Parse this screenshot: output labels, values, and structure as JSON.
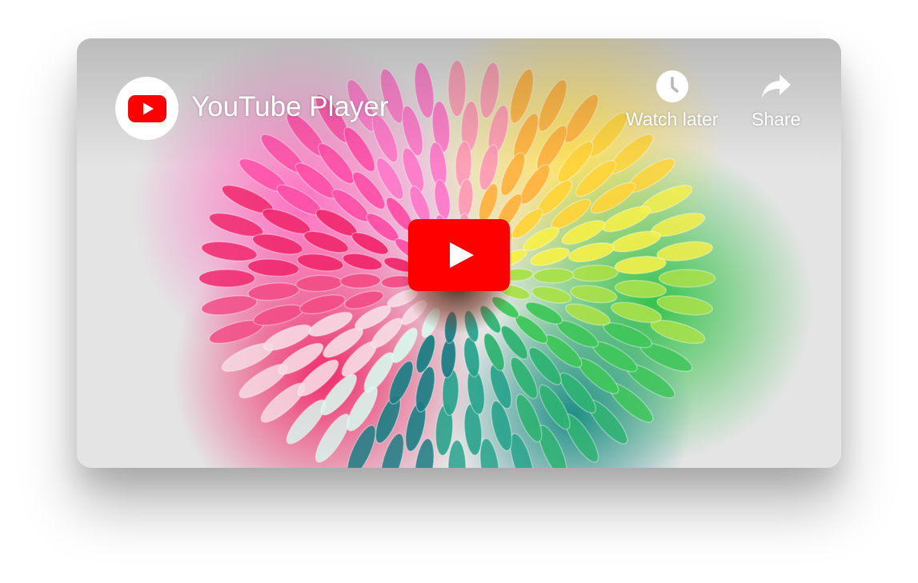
{
  "player": {
    "title": "YouTube Player",
    "channel_icon": "youtube-logo-icon",
    "thumbnail": "rainbow-chrysanthemum-flower",
    "center_button_icon": "play-icon",
    "brand_color": "#ff0000"
  },
  "actions": {
    "watch_later": {
      "label": "Watch later",
      "icon": "clock-icon"
    },
    "share": {
      "label": "Share",
      "icon": "share-arrow-icon"
    }
  }
}
